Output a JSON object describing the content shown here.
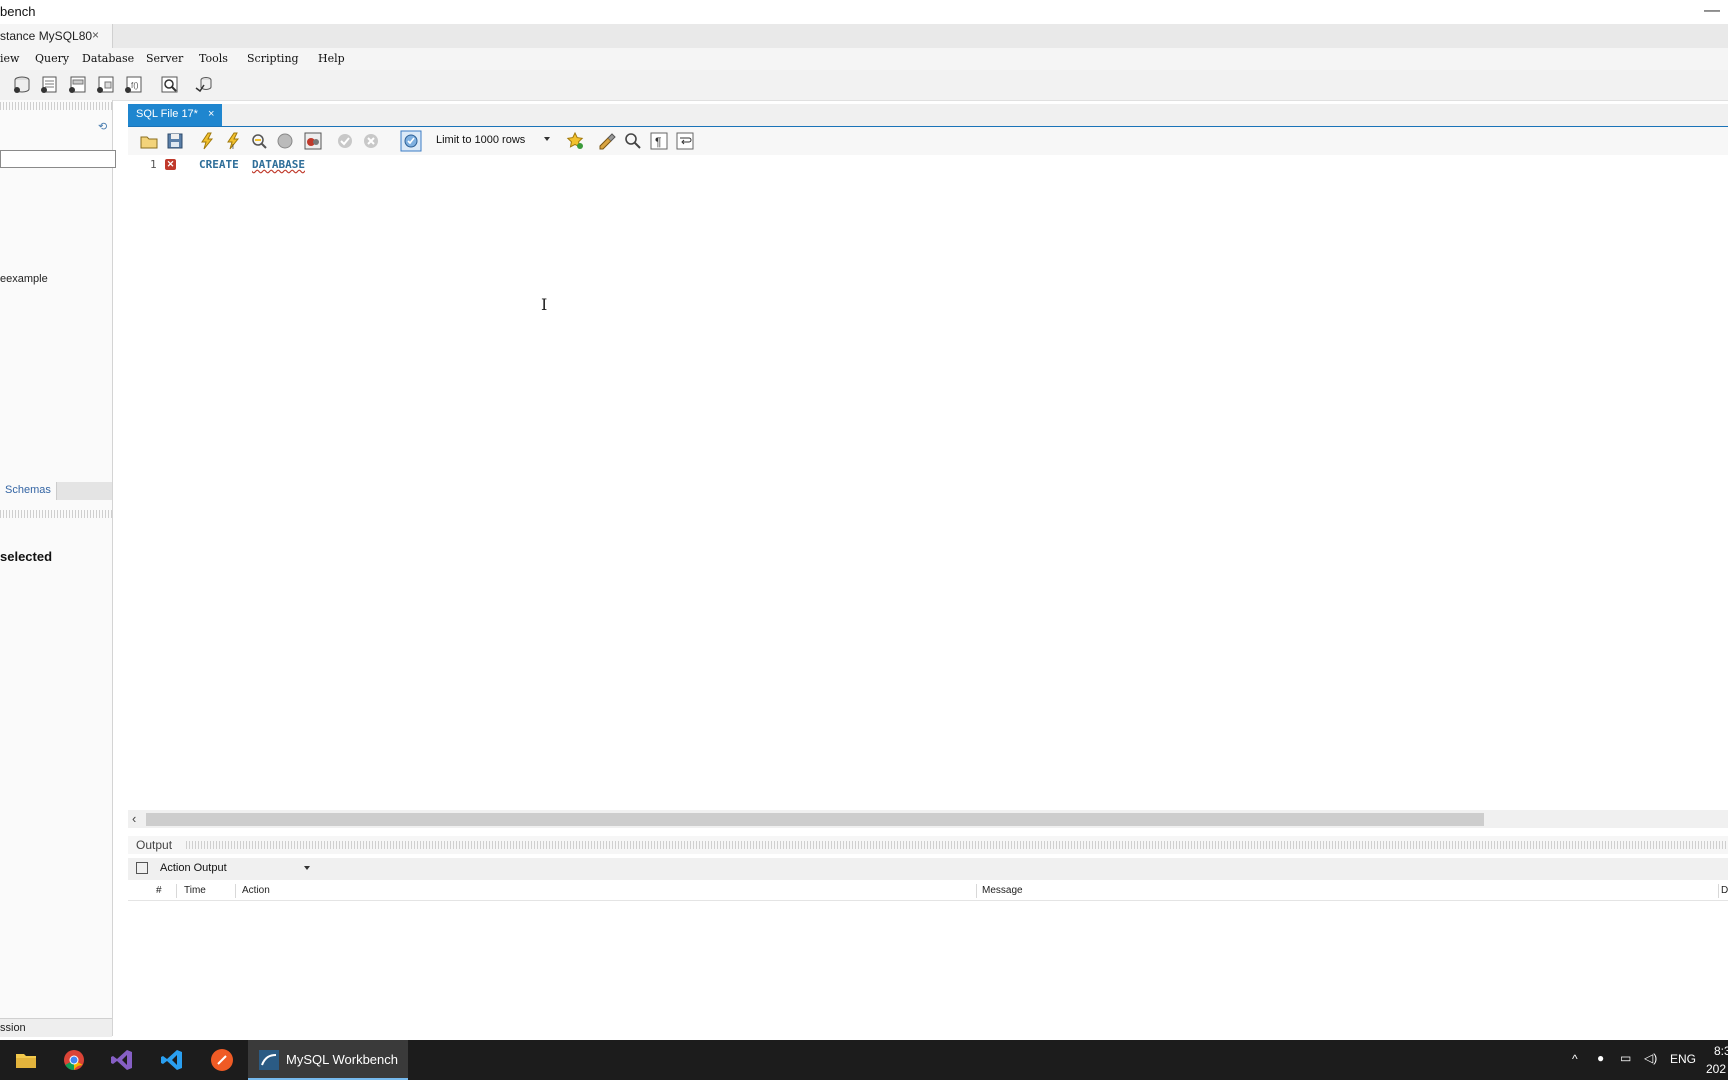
{
  "window": {
    "title": "bench",
    "minimize_glyph": "—"
  },
  "connection_tab": {
    "label": "stance MySQL80",
    "close": "×"
  },
  "menu": [
    "iew",
    "Query",
    "Database",
    "Server",
    "Tools",
    "Scripting",
    "Help"
  ],
  "main_toolbar_icons": [
    "new-connection-icon",
    "open-sql-script-icon",
    "new-query-tab-icon",
    "open-model-icon",
    "create-schema-icon",
    "create-table-icon",
    "inspect-icon",
    "reconnect-icon"
  ],
  "sidebar": {
    "schema_item": "eexample",
    "tab_schemas": "Schemas",
    "selection_text": "selected",
    "bottom_label": "ssion"
  },
  "editor_tab": {
    "label": "SQL File 17*",
    "close": "×"
  },
  "editor_toolbar": {
    "limit_label": "Limit to 1000 rows"
  },
  "editor": {
    "line_number": "1",
    "error_marker": "✕",
    "keyword1": "CREATE",
    "keyword2": "DATABASE",
    "cursor_glyph": "I"
  },
  "output": {
    "header": "Output",
    "selector": "Action Output",
    "columns": [
      "#",
      "Time",
      "Action",
      "Message",
      "D"
    ]
  },
  "taskbar": {
    "active_app": "MySQL Workbench",
    "language": "ENG",
    "time": "8:3",
    "date": "202"
  },
  "colors": {
    "accent_tab": "#1f86cf",
    "keyword": "#2e6e99",
    "error": "#c0392b",
    "taskbar": "#1c1c1c"
  }
}
